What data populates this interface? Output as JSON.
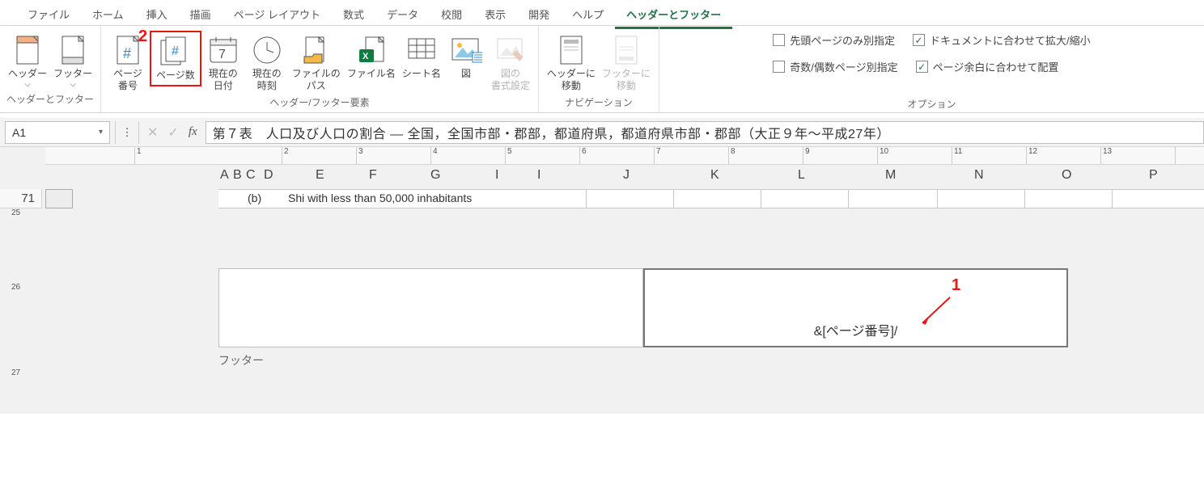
{
  "menu": {
    "items": [
      "ファイル",
      "ホーム",
      "挿入",
      "描画",
      "ページ レイアウト",
      "数式",
      "データ",
      "校閲",
      "表示",
      "開発",
      "ヘルプ",
      "ヘッダーとフッター"
    ],
    "active_index": 11
  },
  "ribbon": {
    "group_hf": {
      "label": "ヘッダーとフッター",
      "header": "ヘッダー",
      "footer": "フッター"
    },
    "group_elements": {
      "label": "ヘッダー/フッター要素",
      "page_number": "ページ\n番号",
      "page_count": "ページ数",
      "current_date": "現在の\n日付",
      "current_time": "現在の\n時刻",
      "file_path": "ファイルの\nパス",
      "file_name": "ファイル名",
      "sheet_name": "シート名",
      "picture": "図",
      "picture_format": "図の\n書式設定"
    },
    "group_nav": {
      "label": "ナビゲーション",
      "goto_header": "ヘッダーに\n移動",
      "goto_footer": "フッターに\n移動"
    },
    "group_options": {
      "label": "オプション",
      "diff_first": "先頭ページのみ別指定",
      "diff_oddeven": "奇数/偶数ページ別指定",
      "scale_doc": "ドキュメントに合わせて拡大/縮小",
      "align_margins": "ページ余白に合わせて配置"
    }
  },
  "annotations": {
    "two": "2",
    "one": "1"
  },
  "formula_bar": {
    "cell_ref": "A1",
    "fx": "fx",
    "text": "第７表　人口及び人口の割合 ― 全国，全国市部・郡部，都道府県，都道府県市部・郡部（大正９年～平成27年）"
  },
  "ruler_h": [
    1,
    2,
    3,
    4,
    5,
    6,
    7,
    8,
    9,
    10,
    11,
    12,
    13
  ],
  "columns": [
    "A",
    "B",
    "C",
    "D",
    "E",
    "F",
    "G",
    "I",
    "I",
    "J",
    "K",
    "L",
    "M",
    "N",
    "O",
    "P"
  ],
  "rows": {
    "r1": "71",
    "r25": "25",
    "r26": "26",
    "r27": "27"
  },
  "data": {
    "b": "(b)",
    "desc": "Shi with less than 50,000 inhabitants"
  },
  "footer": {
    "center_text": "&[ページ番号]/",
    "label": "フッター"
  }
}
